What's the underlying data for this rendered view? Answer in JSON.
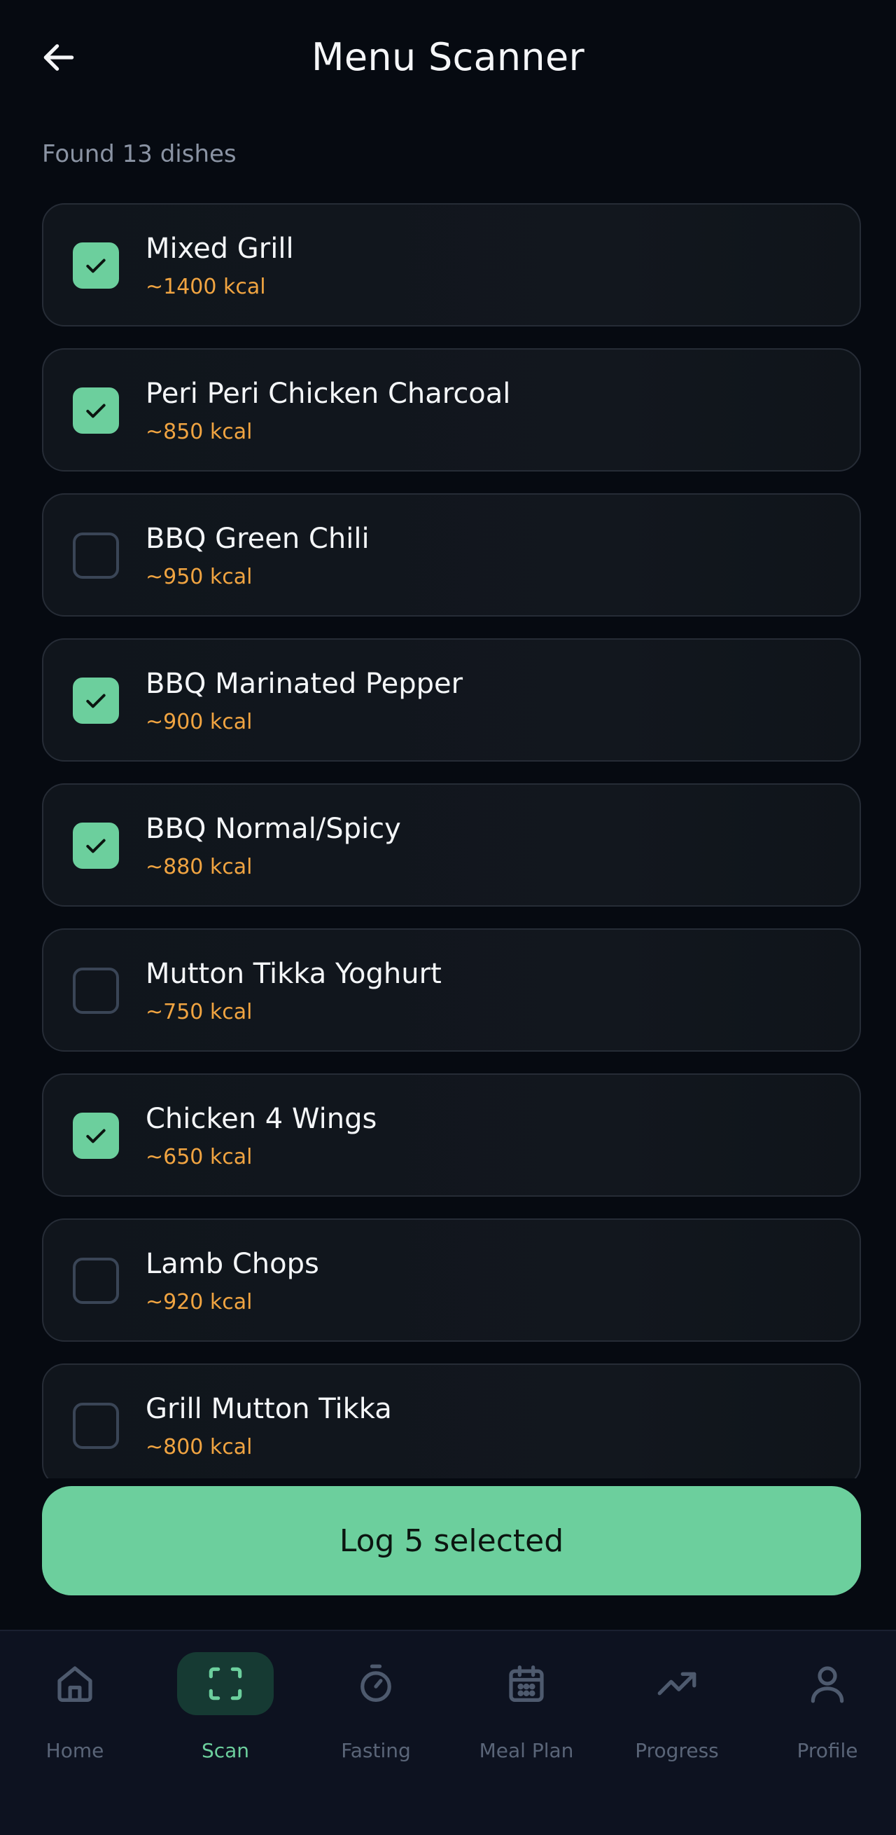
{
  "header": {
    "title": "Menu Scanner",
    "back_icon": "arrow-left-icon"
  },
  "found_text": "Found 13 dishes",
  "dishes": [
    {
      "name": "Mixed Grill",
      "kcal": "~1400 kcal",
      "checked": true
    },
    {
      "name": "Peri Peri Chicken Charcoal",
      "kcal": "~850 kcal",
      "checked": true
    },
    {
      "name": "BBQ Green Chili",
      "kcal": "~950 kcal",
      "checked": false
    },
    {
      "name": "BBQ Marinated Pepper",
      "kcal": "~900 kcal",
      "checked": true
    },
    {
      "name": "BBQ Normal/Spicy",
      "kcal": "~880 kcal",
      "checked": true
    },
    {
      "name": "Mutton Tikka Yoghurt",
      "kcal": "~750 kcal",
      "checked": false
    },
    {
      "name": "Chicken 4 Wings",
      "kcal": "~650 kcal",
      "checked": true
    },
    {
      "name": "Lamb Chops",
      "kcal": "~920 kcal",
      "checked": false
    },
    {
      "name": "Grill Mutton Tikka",
      "kcal": "~800 kcal",
      "checked": false
    }
  ],
  "log_button": {
    "label": "Log 5 selected"
  },
  "nav": {
    "items": [
      {
        "label": "Home",
        "icon": "home-icon",
        "active": false
      },
      {
        "label": "Scan",
        "icon": "scan-icon",
        "active": true
      },
      {
        "label": "Fasting",
        "icon": "timer-icon",
        "active": false
      },
      {
        "label": "Meal Plan",
        "icon": "calendar-icon",
        "active": false
      },
      {
        "label": "Progress",
        "icon": "trending-up-icon",
        "active": false
      },
      {
        "label": "Profile",
        "icon": "user-icon",
        "active": false
      }
    ]
  },
  "colors": {
    "accent": "#6ccf9d",
    "kcal": "#f0a441",
    "background": "#060a11",
    "card_border": "#262c36",
    "nav_inactive": "#5a6578"
  }
}
